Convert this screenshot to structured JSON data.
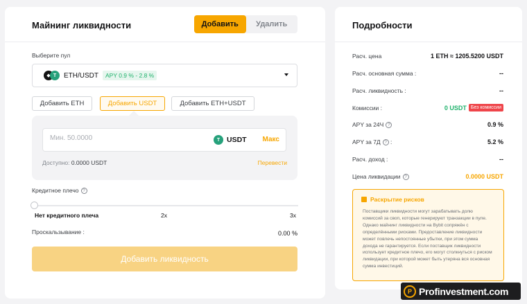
{
  "mining": {
    "title": "Майнинг ликвидности",
    "tab_add": "Добавить",
    "tab_remove": "Удалить",
    "pool_label": "Выберите пул",
    "pool_name": "ETH/USDT",
    "pool_apy": "APY 0.9 % - 2.8 %",
    "options": [
      "Добавить ETH",
      "Добавить USDT",
      "Добавить ETH+USDT"
    ],
    "amount_placeholder": "Мин. 50.0000",
    "amount_token": "USDT",
    "max_label": "Макс",
    "available_label": "Доступно:",
    "available_value": "0.0000 USDT",
    "transfer_label": "Перевести",
    "leverage_label": "Кредитное плечо",
    "leverage_ticks": [
      "Нет кредитного плеча",
      "2x",
      "3x"
    ],
    "leverage_value": 0,
    "slippage_label": "Проскальзывание :",
    "slippage_value": "0.00 %",
    "submit_label": "Добавить ликвидность"
  },
  "details": {
    "title": "Подробности",
    "rows": [
      {
        "label": "Расч. цена",
        "value": "1 ETH ≈ 1205.5200 USDT"
      },
      {
        "label": "Расч. основная сумма :",
        "value": "--"
      },
      {
        "label": "Расч. ликвидность :",
        "value": "--"
      },
      {
        "label": "Комиссии :",
        "value": "0 USDT",
        "badge": "Без комиссии"
      },
      {
        "label": "APY за 24Ч",
        "value": "0.9 %"
      },
      {
        "label": "APY за 7Д",
        "value": "5.2 %"
      },
      {
        "label": "Расч. доход :",
        "value": "--"
      },
      {
        "label": "Цена ликвидации",
        "value": "0.0000 USDT"
      }
    ],
    "risk_title": "Раскрытие рисков",
    "risk_text": "Поставщики ликвидности могут зарабатывать долю комиссий за своп, которые генерируют транзакции в пуле. Однако майнинг ликвидности на Bybit сопряжён с определёнными рисками. Предоставление ликвидности может повлечь непостоянные убытки, при этом сумма дохода не гарантируется. Если поставщик ликвидности использует кредитное плечо, его могут столкнуться с риском ликвидации, при которой может быть утеряна вся основная сумма инвестиций."
  },
  "watermark": {
    "text": "Profinvestment.com",
    "logo": "P"
  },
  "colors": {
    "accent": "#f7a600",
    "green": "#20b26c",
    "red": "#ef454a"
  }
}
